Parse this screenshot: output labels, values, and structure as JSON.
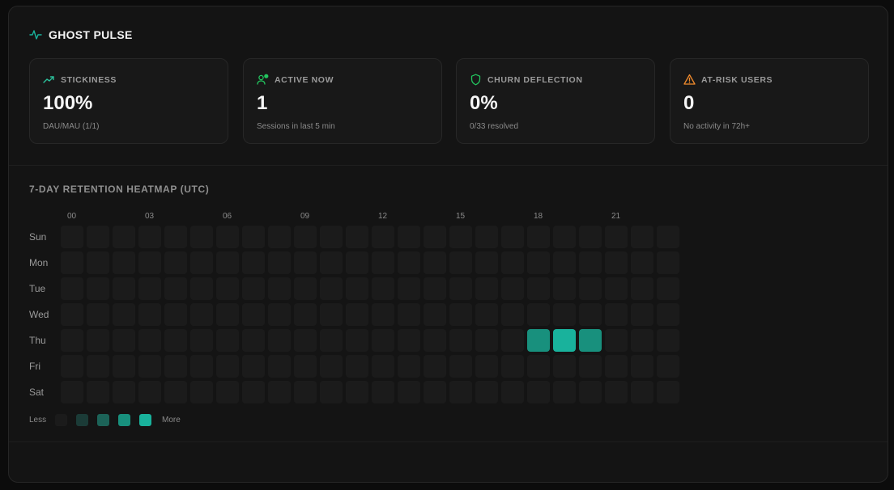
{
  "app": {
    "title": "GHOST PULSE",
    "accent": "#19b29c"
  },
  "cards": [
    {
      "label": "STICKINESS",
      "icon": "trending-up-icon",
      "icon_color": "#2bbf9a",
      "value": "100%",
      "sub": "DAU/MAU (1/1)"
    },
    {
      "label": "ACTIVE NOW",
      "icon": "users-icon",
      "icon_color": "#22c55e",
      "value": "1",
      "sub": "Sessions in last 5 min"
    },
    {
      "label": "CHURN DEFLECTION",
      "icon": "shield-icon",
      "icon_color": "#22c55e",
      "value": "0%",
      "sub": "0/33 resolved"
    },
    {
      "label": "AT-RISK USERS",
      "icon": "alert-triangle-icon",
      "icon_color": "#f08a2c",
      "value": "0",
      "sub": "No activity in 72h+"
    }
  ],
  "heatmap": {
    "title": "7-DAY RETENTION HEATMAP (UTC)",
    "hour_labels": [
      "00",
      "03",
      "06",
      "09",
      "12",
      "15",
      "18",
      "21"
    ],
    "days": [
      "Sun",
      "Mon",
      "Tue",
      "Wed",
      "Thu",
      "Fri",
      "Sat"
    ],
    "hours_per_day": 24,
    "active_cells": [
      {
        "day": "Thu",
        "hour": 18,
        "level": 3
      },
      {
        "day": "Thu",
        "hour": 19,
        "level": 4
      },
      {
        "day": "Thu",
        "hour": 20,
        "level": 3
      }
    ],
    "level_colors": [
      "#1b1b1b",
      "#1b3b37",
      "#1c6358",
      "#18907d",
      "#19b29c"
    ],
    "legend": {
      "less": "Less",
      "more": "More"
    }
  }
}
